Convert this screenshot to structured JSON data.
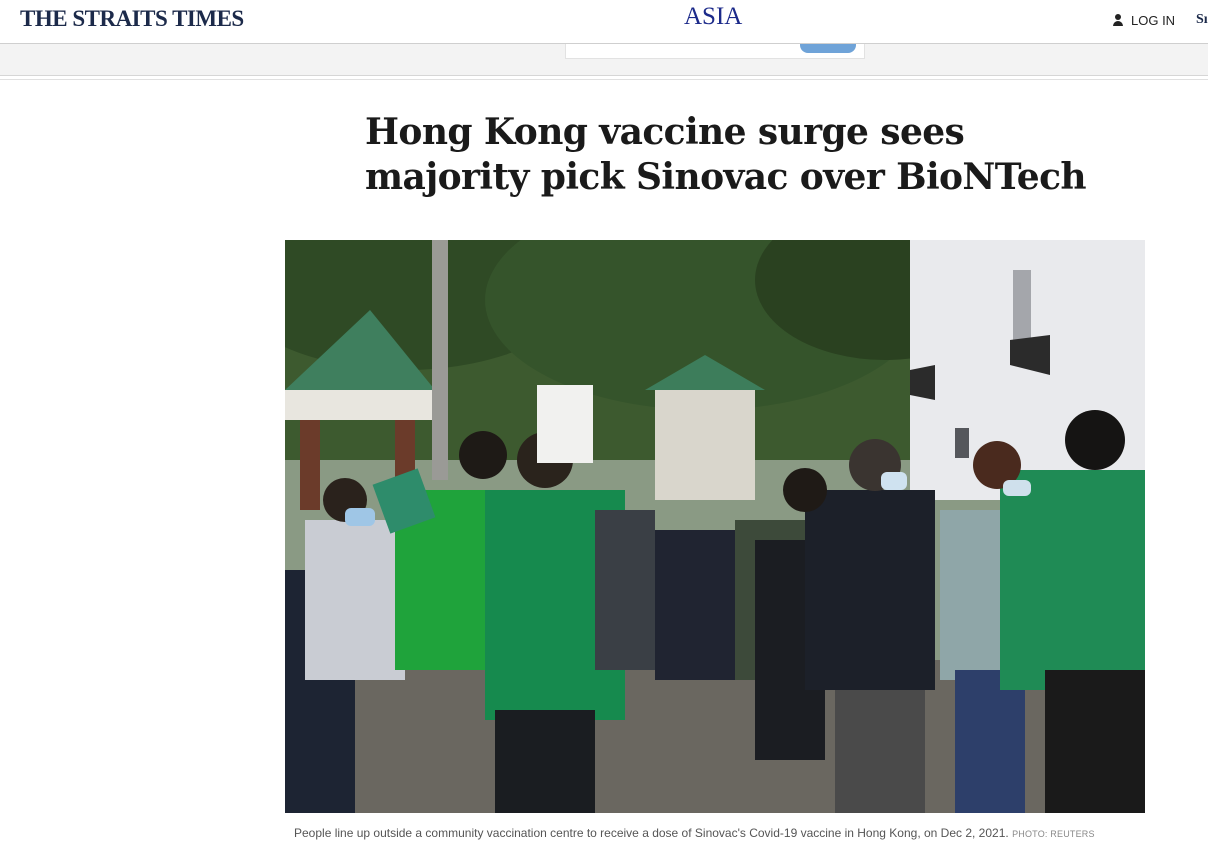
{
  "header": {
    "logo": "THE STRAITS TIMES",
    "section": "ASIA",
    "login_label": "LOG IN",
    "subscribe_partial": "Sı"
  },
  "search": {
    "placeholder": ""
  },
  "article": {
    "headline": "Hong Kong vaccine surge sees majority pick Sinovac over BioNTech",
    "photo_alt": "People line up outside a community vaccination centre",
    "caption": "People line up outside a community vaccination centre to receive a dose of Sinovac's Covid-19 vaccine in Hong Kong, on Dec 2, 2021.",
    "credit": "PHOTO: REUTERS"
  },
  "colors": {
    "logo": "#1c2a4a",
    "section": "#1c2a8a",
    "search_button": "#6fa3d8"
  },
  "icons": {
    "login": "user-icon"
  }
}
